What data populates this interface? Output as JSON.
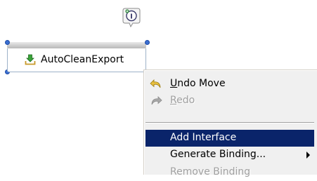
{
  "canvas": {
    "interface_badge_icon": "interface-icon",
    "component": {
      "name": "AutoCleanExport",
      "icon": "export-component-icon",
      "selected": true
    }
  },
  "context_menu": {
    "items": [
      {
        "label_mnemonic": "U",
        "label_rest": "ndo Move",
        "icon": "undo-icon",
        "enabled": true
      },
      {
        "label_mnemonic": "R",
        "label_rest": "edo",
        "icon": "redo-icon",
        "enabled": false
      },
      {
        "label": "Add Interface",
        "enabled": true,
        "highlighted": true
      },
      {
        "label": "Generate Binding...",
        "enabled": true,
        "has_submenu": true
      },
      {
        "label": "Remove Binding",
        "enabled": false,
        "clipped": true
      }
    ]
  },
  "colors": {
    "menu_background": "#f0f0f0",
    "highlight": "#0a246a",
    "selection_handle": "#3b6fd1"
  }
}
